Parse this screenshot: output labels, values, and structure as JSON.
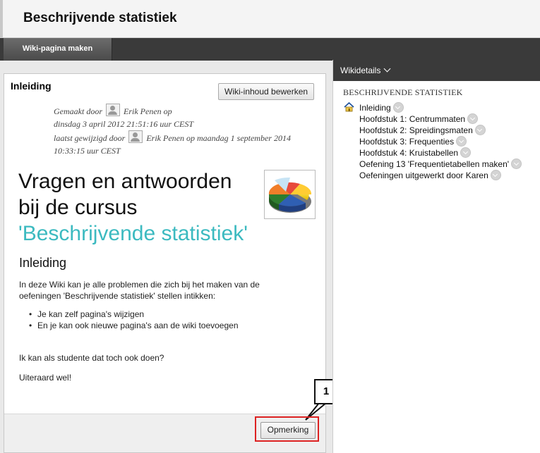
{
  "page": {
    "title": "Beschrijvende statistiek"
  },
  "toolbar": {
    "create_page_label": "Wiki-pagina maken"
  },
  "content": {
    "section_heading": "Inleiding",
    "edit_button_label": "Wiki-inhoud bewerken",
    "meta": {
      "created_prefix": "Gemaakt door",
      "created_rest": "Erik Penen op",
      "created_date": "dinsdag 3 april 2012 21:51:16 uur CEST",
      "modified_prefix": "laatst gewijzigd door",
      "modified_rest": "Erik Penen op maandag 1 september 2014",
      "modified_time": "10:33:15 uur CEST"
    },
    "big_title_line1": "Vragen en antwoorden",
    "big_title_line2": "bij de cursus",
    "big_title_line3": "'Beschrijvende statistiek'",
    "sub_heading": "Inleiding",
    "intro_line1": "In deze Wiki kan je alle problemen die zich bij het maken van de",
    "intro_line2": "oefeningen 'Beschrijvende statistiek' stellen intikken:",
    "bullets": [
      "Je kan zelf pagina's wijzigen",
      "En je kan ook nieuwe pagina's aan de wiki toevoegen"
    ],
    "question": "Ik kan als studente dat toch ook doen?",
    "answer": "Uiteraard wel!",
    "remark_button_label": "Opmerking"
  },
  "callout": {
    "number": "1"
  },
  "sidebar": {
    "header_label": "Wikidetails",
    "title": "BESCHRIJVENDE STATISTIEK",
    "tree": [
      "Inleiding",
      "Hoofdstuk 1: Centrummaten",
      "Hoofdstuk 2: Spreidingsmaten",
      "Hoofdstuk 3: Frequenties",
      "Hoofdstuk 4: Kruistabellen",
      "Oefening 13 'Frequentietabellen maken'",
      "Oefeningen uitgewerkt door Karen"
    ]
  },
  "colors": {
    "teal_title": "#3cbac0",
    "dark_bar": "#3a3a3a",
    "highlight": "#dd2222"
  }
}
